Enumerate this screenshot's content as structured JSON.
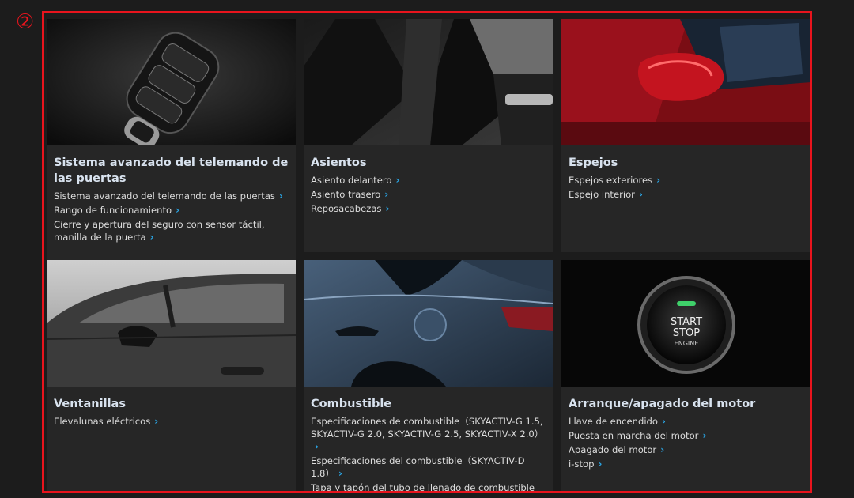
{
  "marker": "②",
  "chevron": "›",
  "cards": [
    {
      "title": "Sistema avanzado del telemando de las puertas",
      "links": [
        "Sistema avanzado del telemando de las puertas",
        "Rango de funcionamiento",
        "Cierre y apertura del seguro con sensor táctil, manilla de la puerta"
      ],
      "image_icon": "key-fob-icon"
    },
    {
      "title": "Asientos",
      "links": [
        "Asiento delantero",
        "Asiento trasero",
        "Reposacabezas"
      ],
      "image_icon": "seat-icon"
    },
    {
      "title": "Espejos",
      "links": [
        "Espejos exteriores",
        "Espejo interior"
      ],
      "image_icon": "mirror-icon"
    },
    {
      "title": "Ventanillas",
      "links": [
        "Elevalunas eléctricos"
      ],
      "image_icon": "window-icon"
    },
    {
      "title": "Combustible",
      "links": [
        "Especificaciones de combustible（SKYACTIV-G 1.5, SKYACTIV-G 2.0, SKYACTIV-G 2.5, SKYACTIV-X 2.0）",
        "Especificaciones del combustible（SKYACTIV-D 1.8）",
        "Tapa y tapón del tubo de llenado de combustible"
      ],
      "image_icon": "fuel-door-icon"
    },
    {
      "title": "Arranque/apagado del motor",
      "links": [
        "Llave de encendido",
        "Puesta en marcha del motor",
        "Apagado del motor",
        "i-stop"
      ],
      "image_icon": "start-stop-button-icon",
      "button_text": [
        "START",
        "STOP",
        "ENGINE"
      ]
    }
  ],
  "colors": {
    "frame": "#e8141d",
    "card_bg": "#262626",
    "title": "#d8e2ee",
    "link": "#dcdcdc",
    "chevron": "#2aa6e6",
    "car_red": "#b3121e"
  }
}
